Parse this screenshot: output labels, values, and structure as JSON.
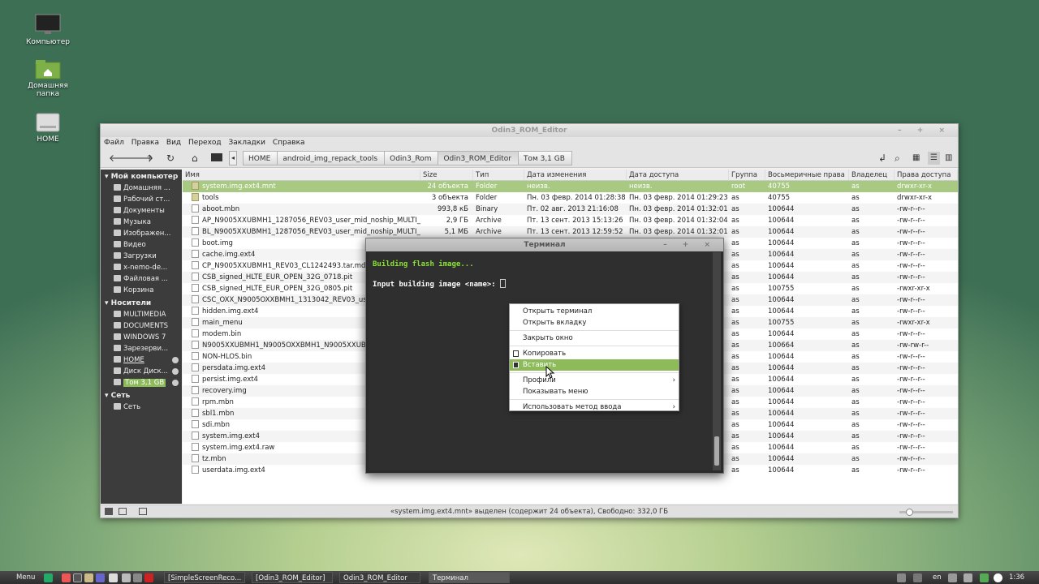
{
  "desktop": {
    "icons": [
      {
        "label": "Компьютер"
      },
      {
        "label": "Домашняя папка"
      },
      {
        "label": "HOME"
      }
    ]
  },
  "fm": {
    "title": "Odin3_ROM_Editor",
    "menu": [
      "Файл",
      "Правка",
      "Вид",
      "Переход",
      "Закладки",
      "Справка"
    ],
    "breadcrumbs": [
      "HOME",
      "android_img_repack_tools",
      "Odin3_Rom",
      "Odin3_ROM_Editor",
      "Том 3,1 GB"
    ],
    "sidebar": {
      "sections": [
        {
          "title": "Мой компьютер",
          "items": [
            "Домашняя ...",
            "Рабочий ст...",
            "Документы",
            "Музыка",
            "Изображен...",
            "Видео",
            "Загрузки",
            "x-nemo-de...",
            "Файловая ...",
            "Корзина"
          ]
        },
        {
          "title": "Носители",
          "items": [
            "MULTIMEDIA",
            "DOCUMENTS",
            "WINDOWS 7",
            "Зарезерви...",
            "HOME",
            "Диск Диск...",
            "Том 3,1 GB"
          ]
        },
        {
          "title": "Сеть",
          "items": [
            "Сеть"
          ]
        }
      ]
    },
    "columns": [
      "Имя",
      "Size",
      "Тип",
      "Дата изменения",
      "Дата доступа",
      "Группа",
      "Восьмеричные права",
      "Владелец",
      "Права доступа"
    ],
    "rows": [
      [
        "system.img.ext4.mnt",
        "24 объекта",
        "Folder",
        "неизв.",
        "неизв.",
        "root",
        "40755",
        "as",
        "drwxr-xr-x"
      ],
      [
        "tools",
        "3 объекта",
        "Folder",
        "Пн. 03 февр. 2014 01:28:38",
        "Пн. 03 февр. 2014 01:29:23",
        "as",
        "40755",
        "as",
        "drwxr-xr-x"
      ],
      [
        "aboot.mbn",
        "993,8 кБ",
        "Binary",
        "Пт. 02 авг. 2013 21:16:08",
        "Пн. 03 февр. 2014 01:32:01",
        "as",
        "100644",
        "as",
        "-rw-r--r--"
      ],
      [
        "AP_N9005XXUBMH1_1287056_REV03_user_mid_noship_MULTI_...",
        "2,9 ГБ",
        "Archive",
        "Пт. 13 сент. 2013 15:13:26",
        "Пн. 03 февр. 2014 01:32:04",
        "as",
        "100644",
        "as",
        "-rw-r--r--"
      ],
      [
        "BL_N9005XXUBMH1_1287056_REV03_user_mid_noship_MULTI_...",
        "5,1 МБ",
        "Archive",
        "Пт. 13 сент. 2013 12:59:52",
        "Пн. 03 февр. 2014 01:32:01",
        "as",
        "100644",
        "as",
        "-rw-r--r--"
      ],
      [
        "boot.img",
        "",
        "",
        "",
        "",
        "as",
        "100644",
        "as",
        "-rw-r--r--"
      ],
      [
        "cache.img.ext4",
        "",
        "",
        "",
        "",
        "as",
        "100644",
        "as",
        "-rw-r--r--"
      ],
      [
        "CP_N9005XXUBMH1_REV03_CL1242493.tar.md5",
        "",
        "",
        "",
        "",
        "as",
        "100644",
        "as",
        "-rw-r--r--"
      ],
      [
        "CSB_signed_HLTE_EUR_OPEN_32G_0718.pit",
        "",
        "",
        "",
        "",
        "as",
        "100644",
        "as",
        "-rw-r--r--"
      ],
      [
        "CSB_signed_HLTE_EUR_OPEN_32G_0805.pit",
        "",
        "",
        "",
        "",
        "as",
        "100755",
        "as",
        "-rwxr-xr-x"
      ],
      [
        "CSC_OXX_N9005OXXBMH1_1313042_REV03_user_",
        "",
        "",
        "",
        "",
        "as",
        "100644",
        "as",
        "-rw-r--r--"
      ],
      [
        "hidden.img.ext4",
        "",
        "",
        "",
        "",
        "as",
        "100644",
        "as",
        "-rw-r--r--"
      ],
      [
        "main_menu",
        "",
        "",
        "",
        "",
        "as",
        "100755",
        "as",
        "-rwxr-xr-x"
      ],
      [
        "modem.bin",
        "",
        "",
        "",
        "",
        "as",
        "100644",
        "as",
        "-rw-r--r--"
      ],
      [
        "N9005XXUBMH1_N9005OXXBMH1_N9005XXUBMH",
        "",
        "",
        "",
        "",
        "as",
        "100664",
        "as",
        "-rw-rw-r--"
      ],
      [
        "NON-HLOS.bin",
        "",
        "",
        "",
        "",
        "as",
        "100644",
        "as",
        "-rw-r--r--"
      ],
      [
        "persdata.img.ext4",
        "",
        "",
        "",
        "",
        "as",
        "100644",
        "as",
        "-rw-r--r--"
      ],
      [
        "persist.img.ext4",
        "",
        "",
        "",
        "",
        "as",
        "100644",
        "as",
        "-rw-r--r--"
      ],
      [
        "recovery.img",
        "",
        "",
        "",
        "",
        "as",
        "100644",
        "as",
        "-rw-r--r--"
      ],
      [
        "rpm.mbn",
        "",
        "",
        "",
        "",
        "as",
        "100644",
        "as",
        "-rw-r--r--"
      ],
      [
        "sbl1.mbn",
        "",
        "",
        "",
        "",
        "as",
        "100644",
        "as",
        "-rw-r--r--"
      ],
      [
        "sdi.mbn",
        "",
        "",
        "",
        "",
        "as",
        "100644",
        "as",
        "-rw-r--r--"
      ],
      [
        "system.img.ext4",
        "",
        "",
        "",
        "",
        "as",
        "100644",
        "as",
        "-rw-r--r--"
      ],
      [
        "system.img.ext4.raw",
        "",
        "",
        "",
        "",
        "as",
        "100644",
        "as",
        "-rw-r--r--"
      ],
      [
        "tz.mbn",
        "",
        "",
        "",
        "",
        "as",
        "100644",
        "as",
        "-rw-r--r--"
      ],
      [
        "userdata.img.ext4",
        "",
        "",
        "",
        "",
        "as",
        "100644",
        "as",
        "-rw-r--r--"
      ]
    ],
    "status": "«system.img.ext4.mnt» выделен (содержит 24 объекта), Свободно: 332,0 ГБ"
  },
  "terminal": {
    "title": "Терминал",
    "line1": "Building flash image...",
    "line2": "Input building image <name>: "
  },
  "context_menu": {
    "items": [
      "Открыть терминал",
      "Открыть вкладку",
      "Закрыть окно",
      "Копировать",
      "Вставить",
      "Профили",
      "Показывать меню",
      "Использовать метод ввода"
    ],
    "highlighted": "Вставить"
  },
  "taskbar": {
    "menu": "Menu",
    "windows": [
      "[SimpleScreenReco...",
      "[Odin3_ROM_Editor]",
      "Odin3_ROM_Editor",
      "Терминал"
    ],
    "lang": "en",
    "clock": "1:36"
  },
  "colors": {
    "accent": "#8dbb5a",
    "selection": "#a8c982",
    "terminal_green": "#8ae234"
  }
}
